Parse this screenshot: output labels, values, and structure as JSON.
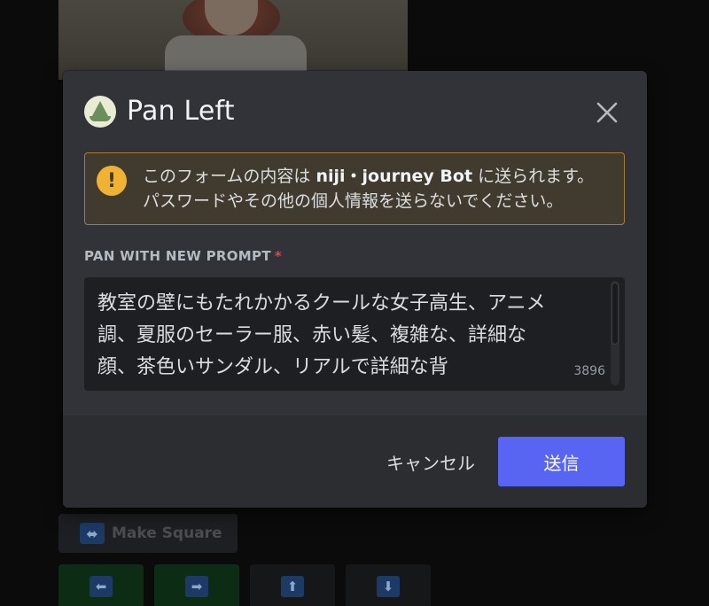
{
  "background": {
    "make_square_label": "Make Square",
    "make_square_icon": "left-right-arrow-icon",
    "arrow_buttons": [
      {
        "icon": "arrow-left-icon",
        "glyph": "⬅"
      },
      {
        "icon": "arrow-right-icon",
        "glyph": "➡"
      },
      {
        "icon": "arrow-up-icon",
        "glyph": "⬆"
      },
      {
        "icon": "arrow-down-icon",
        "glyph": "⬇"
      }
    ]
  },
  "modal": {
    "title": "Pan Left",
    "close_icon": "close-icon",
    "warning": {
      "icon": "exclamation-icon",
      "text_before": "このフォームの内容は ",
      "bot_name": "niji・journey Bot",
      "text_after": " に送られます。",
      "line2": "パスワードやその他の個人情報を送らないでください。"
    },
    "field": {
      "label": "PAN WITH NEW PROMPT",
      "required_mark": "*",
      "value": "教室の壁にもたれかかるクールな女子高生、アニメ調、夏服のセーラー服、赤い髪、複雑な、詳細な顔、茶色いサンダル、リアルで詳細な背",
      "char_count": "3896"
    },
    "cancel_label": "キャンセル",
    "submit_label": "送信"
  },
  "colors": {
    "modal_bg": "#313338",
    "footer_bg": "#2b2d31",
    "accent": "#5865f2",
    "warning_border": "#a87c2a",
    "warning_icon": "#f0b232",
    "required": "#f23f43"
  }
}
